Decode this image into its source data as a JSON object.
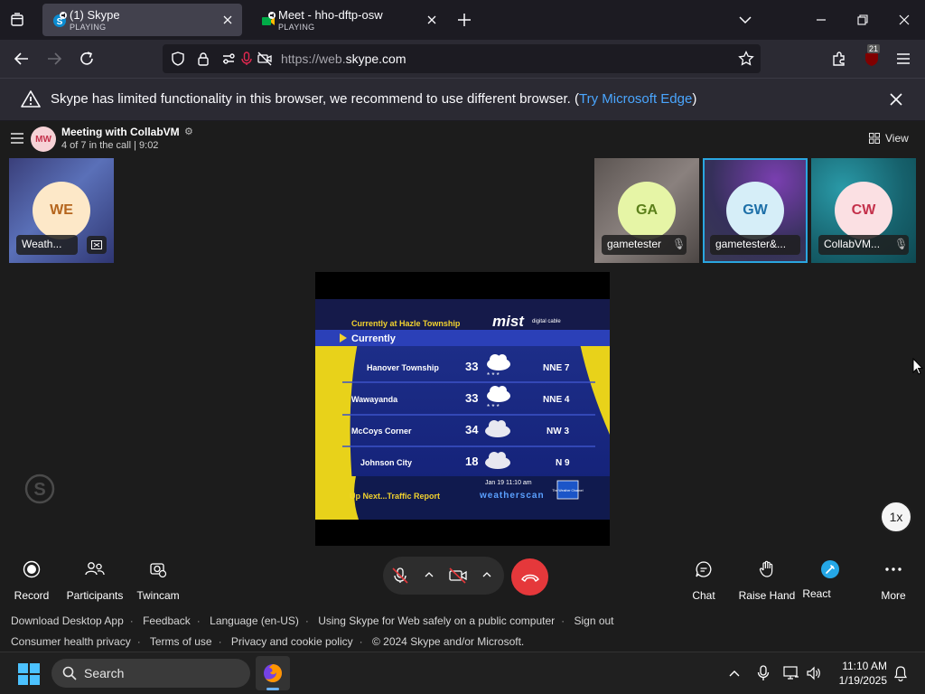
{
  "browser": {
    "tabs": [
      {
        "title": "(1) Skype",
        "status": "PLAYING",
        "active": true
      },
      {
        "title": "Meet - hho-dftp-osw",
        "status": "PLAYING",
        "active": false
      }
    ],
    "url_dim_prefix": "https://web.",
    "url_host": "skype.com",
    "extension_badge": "21"
  },
  "notification": {
    "message": "Skype has limited functionality in this browser, we recommend to use different browser. (",
    "link": "Try Microsoft Edge",
    "suffix": ")"
  },
  "meeting": {
    "avatar_initials": "MW",
    "title": "Meeting with CollabVM",
    "subtitle": "4 of 7 in the call | 9:02",
    "view_label": "View",
    "speed_label": "1x",
    "participants": [
      {
        "initials": "WE",
        "name": "Weath...",
        "color": "#b5651d",
        "bg": "#fde8c8"
      },
      {
        "initials": "GA",
        "name": "gametester",
        "color": "#5b7f1a",
        "bg": "#e6f5a6"
      },
      {
        "initials": "GW",
        "name": "gametester&...",
        "color": "#1d6fa8",
        "bg": "#d6eef8"
      },
      {
        "initials": "CW",
        "name": "CollabVM...",
        "color": "#c4314b",
        "bg": "#fbe0e3"
      }
    ],
    "video": {
      "location_title": "Currently at Hazle Township",
      "brand": "mist",
      "brand_sub": "digital cable",
      "section": "Currently",
      "rows": [
        {
          "place": "Hanover Township",
          "temp": "33",
          "wind": "NNE 7"
        },
        {
          "place": "Wawayanda",
          "temp": "33",
          "wind": "NNE 4"
        },
        {
          "place": "McCoys Corner",
          "temp": "34",
          "wind": "NW 3"
        },
        {
          "place": "Johnson City",
          "temp": "18",
          "wind": "N 9"
        }
      ],
      "datetime": "Jan 19  11:10 am",
      "up_next": "Up Next...Traffic Report",
      "network": "weatherscan",
      "logo_text": "The Weather Channel"
    }
  },
  "controls": {
    "record": "Record",
    "participants": "Participants",
    "twincam": "Twincam",
    "chat": "Chat",
    "raise_hand": "Raise Hand",
    "react": "React",
    "more": "More"
  },
  "footer": {
    "row1": [
      "Download Desktop App",
      "Feedback",
      "Language (en-US)",
      "Using Skype for Web safely on a public computer",
      "Sign out"
    ],
    "row2": [
      "Consumer health privacy",
      "Terms of use",
      "Privacy and cookie policy",
      "© 2024 Skype and/or Microsoft."
    ]
  },
  "taskbar": {
    "search_label": "Search",
    "time": "11:10 AM",
    "date": "1/19/2025"
  }
}
